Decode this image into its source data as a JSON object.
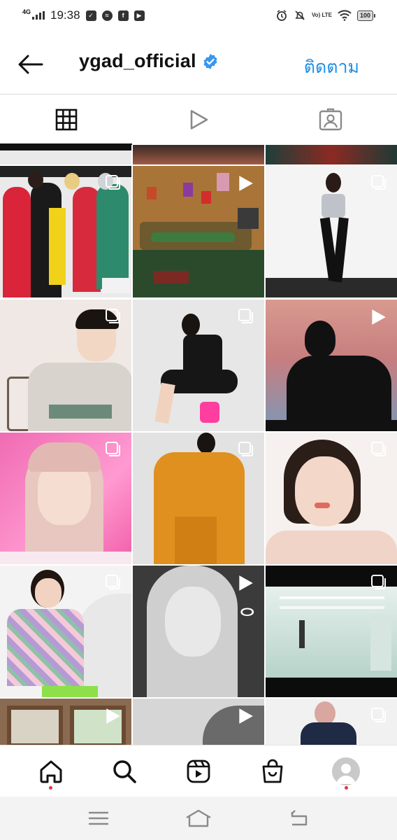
{
  "status_bar": {
    "network": "4G",
    "time": "19:38",
    "volte": "Vo) LTE",
    "battery": "100"
  },
  "header": {
    "username": "ygad_official",
    "follow_label": "ติดตาม",
    "verified": true
  },
  "tabs": [
    {
      "name": "posts-grid-icon",
      "active": true
    },
    {
      "name": "reels-play-icon",
      "active": false
    },
    {
      "name": "tagged-person-icon",
      "active": false
    }
  ],
  "grid_posts": [
    {
      "type": "carousel",
      "subject": "magazine cover group"
    },
    {
      "type": "video",
      "subject": "living room set"
    },
    {
      "type": "carousel",
      "subject": "model silver top"
    },
    {
      "type": "carousel",
      "subject": "model grey sweater"
    },
    {
      "type": "carousel",
      "subject": "model black dress"
    },
    {
      "type": "video",
      "subject": "silhouette profile"
    },
    {
      "type": "carousel",
      "subject": "pink hair portrait"
    },
    {
      "type": "carousel",
      "subject": "orange coat"
    },
    {
      "type": "carousel",
      "subject": "beauty portrait"
    },
    {
      "type": "carousel",
      "subject": "knit cardigan"
    },
    {
      "type": "video",
      "subject": "monochrome portrait"
    },
    {
      "type": "carousel",
      "subject": "empty hall scene"
    },
    {
      "type": "video",
      "subject": "window interior"
    },
    {
      "type": "video",
      "subject": "grey portrait"
    },
    {
      "type": "carousel",
      "subject": "navy sweater"
    }
  ],
  "bottom_nav": [
    {
      "name": "home-icon",
      "dot": true
    },
    {
      "name": "search-icon",
      "dot": false
    },
    {
      "name": "reels-icon",
      "dot": false
    },
    {
      "name": "shop-icon",
      "dot": false
    },
    {
      "name": "profile-avatar",
      "dot": true
    }
  ],
  "colors": {
    "accent": "#1e90e6",
    "verified": "#3897f0",
    "notification_dot": "#e03744"
  }
}
